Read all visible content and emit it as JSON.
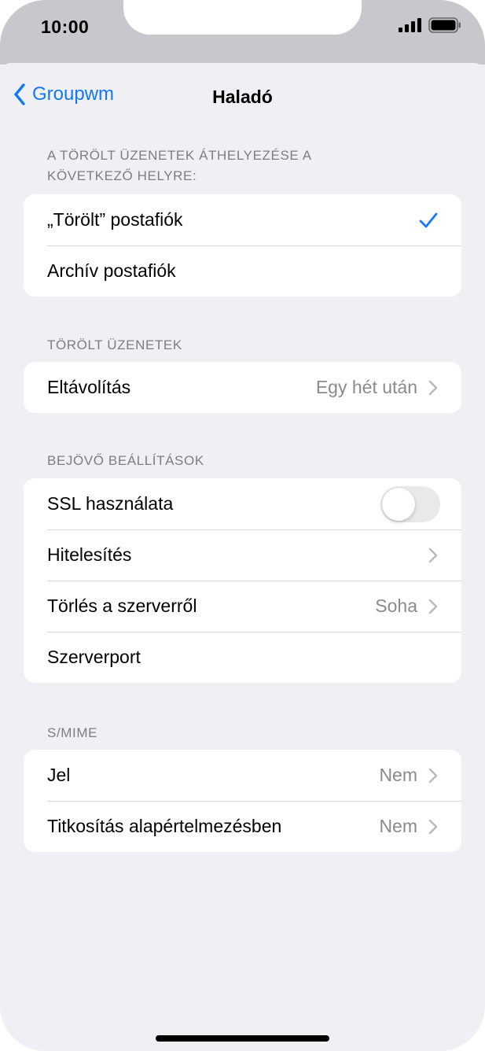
{
  "status_bar": {
    "time": "10:00",
    "icons": [
      "signal-icon",
      "battery-icon"
    ]
  },
  "nav": {
    "back_label": "Groupwm",
    "title": "Haladó"
  },
  "sections": {
    "move_deleted": {
      "header": "A törölt üzenetek áthelyezése a következő helyre:",
      "rows": [
        {
          "label": "„Törölt” postafiók",
          "selected": true
        },
        {
          "label": "Archív postafiók",
          "selected": false
        }
      ]
    },
    "deleted_messages": {
      "header": "Törölt üzenetek",
      "rows": [
        {
          "label": "Eltávolítás",
          "value": "Egy hét után"
        }
      ]
    },
    "incoming": {
      "header": "Bejövő beállítások",
      "rows": [
        {
          "label": "SSL használata",
          "toggle": false
        },
        {
          "label": "Hitelesítés",
          "value": ""
        },
        {
          "label": "Törlés a szerverről",
          "value": "Soha"
        },
        {
          "label": "Szerverport",
          "value": ""
        }
      ]
    },
    "smime": {
      "header": "S/MIME",
      "rows": [
        {
          "label": "Jel",
          "value": "Nem"
        },
        {
          "label": "Titkosítás alapértelmezésben",
          "value": "Nem"
        }
      ]
    }
  },
  "colors": {
    "accent": "#1478f5",
    "background": "#f0eff4",
    "status_bar": "#c8c7cc",
    "secondary_text": "#8a8a8f"
  }
}
